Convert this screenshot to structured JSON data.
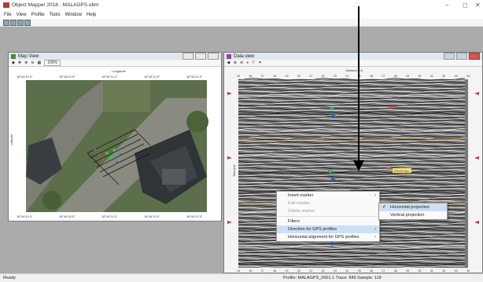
{
  "app": {
    "title": "Object Mapper 2018 - MALAGPS.obm"
  },
  "window_controls": {
    "minimize": "–",
    "maximize": "◻",
    "close": "✕"
  },
  "menu": [
    "File",
    "View",
    "Profile",
    "Tools",
    "Window",
    "Help"
  ],
  "map_view": {
    "title": "Map View",
    "zoom": "100%",
    "x_label": "Longitude",
    "y_label": "Latitude",
    "top_ticks": [
      "18°44'10.0\"",
      "18°44'10.5\"",
      "18°44'11.0\"",
      "18°44'11.5\"",
      "18°44'12.0\""
    ],
    "bottom_ticks": [
      "18°44'10.0\"",
      "18°44'10.5\"",
      "18°44'11.0\"",
      "18°44'11.5\"",
      "18°44'12.0\""
    ]
  },
  "data_view": {
    "title": "Data view",
    "x_label": "Distance [m]",
    "x_ticks": [
      "15",
      "16",
      "17",
      "18",
      "19",
      "20",
      "21",
      "22",
      "23",
      "24",
      "25",
      "26",
      "27",
      "28",
      "29",
      "30",
      "31",
      "32",
      "33",
      "34"
    ],
    "y_label": "Time [ns]",
    "marker_label": "Detected pipe"
  },
  "context_menu": {
    "items": [
      {
        "label": "Insert marker",
        "disabled": false,
        "submenu": true
      },
      {
        "label": "Edit marker",
        "disabled": true,
        "submenu": false
      },
      {
        "label": "Delete marker",
        "disabled": true,
        "submenu": false
      },
      {
        "label": "Filters",
        "disabled": false,
        "submenu": false
      },
      {
        "label": "Direction for GPS profiles",
        "disabled": false,
        "submenu": true,
        "highlighted": true
      },
      {
        "label": "Horizontal alignment for GPS profiles",
        "disabled": false,
        "submenu": true
      }
    ],
    "submenu": [
      {
        "label": "Horizontal projection",
        "checked": true
      },
      {
        "label": "Vertical projection",
        "checked": false
      }
    ]
  },
  "status": {
    "left": "Ready",
    "right": "Profile: MALAGPS_0001.1  Trace: 845   Sample: 118"
  },
  "colors": {
    "accent": "#1a5fb4",
    "menu_highlight": "#cce0f5",
    "mdi_bg": "#ababab"
  }
}
